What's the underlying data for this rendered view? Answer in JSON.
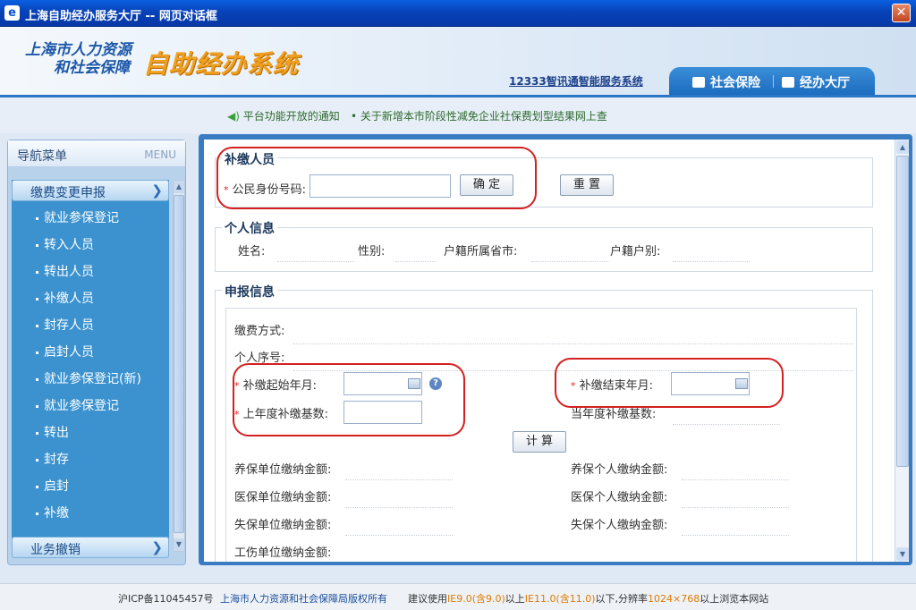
{
  "window": {
    "title": "上海自助经办服务大厅 -- 网页对话框",
    "app_icon": "e",
    "close_glyph": "✕"
  },
  "header": {
    "brand_line1": "上海市人力资源",
    "brand_line2": "和社会保障",
    "system_name": "自助经办系统",
    "link_12333": "12333智讯通智能服务系统",
    "tabs": [
      {
        "label": "社会保险"
      },
      {
        "label": "经办大厅"
      }
    ]
  },
  "notices": [
    {
      "text": "平台功能开放的通知"
    },
    {
      "text": "关于新增本市阶段性减免企业社保费划型结果网上查"
    }
  ],
  "sidebar": {
    "title": "导航菜单",
    "title_en": "MENU",
    "group1": "缴费变更申报",
    "items": [
      {
        "label": "就业参保登记"
      },
      {
        "label": "转入人员"
      },
      {
        "label": "转出人员"
      },
      {
        "label": "补缴人员"
      },
      {
        "label": "封存人员"
      },
      {
        "label": "启封人员"
      },
      {
        "label": "就业参保登记(新)"
      },
      {
        "label": "就业参保登记"
      },
      {
        "label": "转出"
      },
      {
        "label": "封存"
      },
      {
        "label": "启封"
      },
      {
        "label": "补缴"
      }
    ],
    "group2": "业务撤销"
  },
  "form": {
    "section1": {
      "legend": "补缴人员",
      "id_label": "公民身份号码:",
      "id_value": "",
      "confirm_button": "确 定",
      "reset_button": "重 置"
    },
    "section2": {
      "legend": "个人信息",
      "name_label": "姓名:",
      "gender_label": "性别:",
      "province_label": "户籍所属省市:",
      "hukou_type_label": "户籍户别:"
    },
    "section3": {
      "legend": "申报信息",
      "pay_method_label": "缴费方式:",
      "serial_label": "个人序号:",
      "start_month_label": "补缴起始年月:",
      "end_month_label": "补缴结束年月:",
      "last_year_base_label": "上年度补缴基数:",
      "this_year_base_label": "当年度补缴基数:",
      "calc_button": "计 算",
      "pension_unit_label": "养保单位缴纳金额:",
      "pension_personal_label": "养保个人缴纳金额:",
      "medical_unit_label": "医保单位缴纳金额:",
      "medical_personal_label": "医保个人缴纳金额:",
      "unemployment_unit_label": "失保单位缴纳金额:",
      "unemployment_personal_label": "失保个人缴纳金额:",
      "injury_unit_label": "工伤单位缴纳金额:",
      "help_glyph": "?"
    }
  },
  "footer": {
    "icp": "沪ICP备11045457号",
    "copyright": "上海市人力资源和社会保障局版权所有",
    "advice_prefix": "建议使用",
    "ie9": "IE9.0(含9.0)",
    "advice_mid": "以上",
    "ie11": "IE11.0(含11.0)",
    "advice_mid2": "以下,分辨率",
    "resolution": "1024×768",
    "advice_suffix": "以上浏览本网站"
  }
}
